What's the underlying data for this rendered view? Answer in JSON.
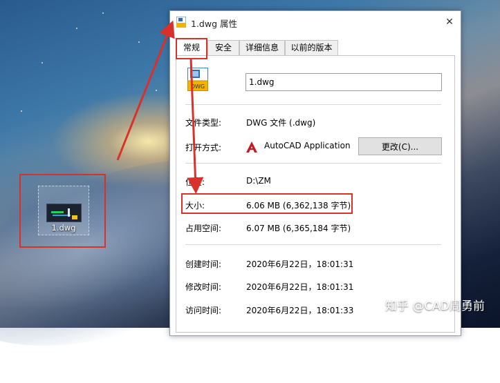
{
  "desktop": {
    "file_icon_label": "1.dwg"
  },
  "window": {
    "title": "1.dwg 属性",
    "close_glyph": "✕",
    "tabs": [
      {
        "label": "常规",
        "active": true
      },
      {
        "label": "安全",
        "active": false
      },
      {
        "label": "详细信息",
        "active": false
      },
      {
        "label": "以前的版本",
        "active": false
      }
    ],
    "file_icon_text": "DWG",
    "filename": "1.dwg",
    "rows": {
      "type": {
        "label": "文件类型:",
        "value": "DWG 文件 (.dwg)"
      },
      "opens_with": {
        "label": "打开方式:",
        "value": "AutoCAD Application",
        "button": "更改(C)..."
      },
      "location": {
        "label": "位置:",
        "value": "D:\\ZM"
      },
      "size": {
        "label": "大小:",
        "value": "6.06 MB (6,362,138 字节)"
      },
      "size_on_disk": {
        "label": "占用空间:",
        "value": "6.07 MB (6,365,184 字节)"
      },
      "created": {
        "label": "创建时间:",
        "value": "2020年6月22日，18:01:31"
      },
      "modified": {
        "label": "修改时间:",
        "value": "2020年6月22日，18:01:31"
      },
      "accessed": {
        "label": "访问时间:",
        "value": "2020年6月22日，18:01:33"
      }
    }
  },
  "watermark": "知乎 @CAD周勇前",
  "colors": {
    "annotation_red": "#d9302a",
    "autocad_red": "#c8171e"
  }
}
